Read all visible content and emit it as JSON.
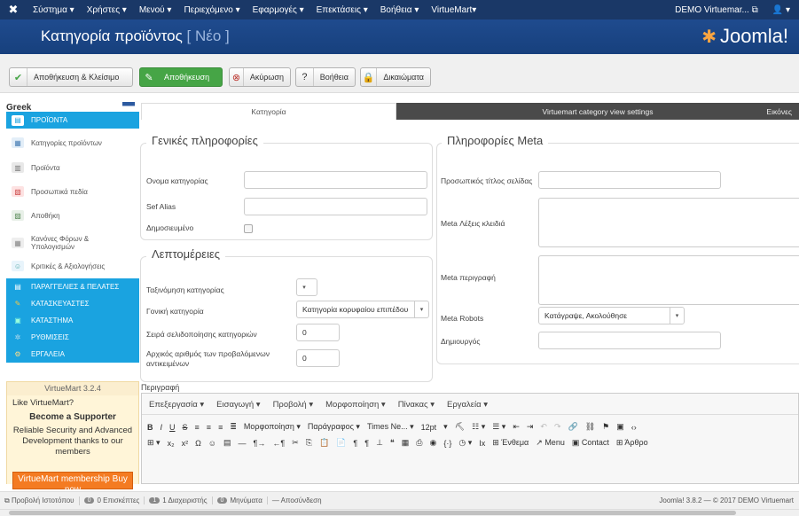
{
  "topbar": {
    "menu": [
      "Σύστημα ▾",
      "Χρήστες ▾",
      "Μενού ▾",
      "Περιεχόμενο ▾",
      "Εφαρμογές ▾",
      "Επεκτάσεις ▾",
      "Βοήθεια ▾",
      "VirtueMart▾"
    ],
    "site": "DEMO Virtuemar...",
    "site_icon": "external-link-icon",
    "user_icon": "user-icon"
  },
  "header": {
    "title": "Κατηγορία προϊόντος",
    "title_sub": "[ Νέο ]",
    "brand": "Joomla!"
  },
  "toolbar": {
    "save_close": "Αποθήκευση & Κλείσιμο",
    "save": "Αποθήκευση",
    "cancel": "Ακύρωση",
    "help": "Βοήθεια",
    "permissions": "Δικαιώματα"
  },
  "sidebar": {
    "language": "Greek",
    "items": [
      {
        "label": "ΠΡΟΪΟΝΤΑ",
        "type": "active"
      },
      {
        "label": "Κατηγορίες προϊόντων",
        "type": "item"
      },
      {
        "label": "Προϊόντα",
        "type": "item"
      },
      {
        "label": "Προσωπικά πεδία",
        "type": "item"
      },
      {
        "label": "Αποθήκη",
        "type": "item"
      },
      {
        "label": "Κανόνες Φόρων & Υπολογισμών",
        "type": "item"
      },
      {
        "label": "Κριτικές & Αξιολογήσεις",
        "type": "item"
      },
      {
        "label": "ΠΑΡΑΓΓΕΛΙΕΣ & ΠΕΛΑΤΕΣ",
        "type": "section"
      },
      {
        "label": "ΚΑΤΑΣΚΕΥΑΣΤΕΣ",
        "type": "section"
      },
      {
        "label": "ΚΑΤΑΣΤΗΜΑ",
        "type": "section"
      },
      {
        "label": "ΡΥΘΜΙΣΕΙΣ",
        "type": "section"
      },
      {
        "label": "ΕΡΓΑΛΕΙΑ",
        "type": "section"
      }
    ],
    "promo": {
      "version": "VirtueMart 3.2.4",
      "question": "Like VirtueMart?",
      "heading": "Become a Supporter",
      "text": "Reliable Security and Advanced Development thanks to our members",
      "buy": "VirtueMart membership Buy now"
    }
  },
  "tabs": {
    "t1": "Κατηγορία",
    "t2": "Virtuemart category view settings",
    "t3": "Εικόνες"
  },
  "general": {
    "legend": "Γενικές πληροφορίες",
    "name_label": "Ονομα κατηγορίας",
    "name_value": "",
    "alias_label": "Sef Alias",
    "alias_value": "",
    "published_label": "Δημοσιευμένο"
  },
  "details": {
    "legend": "Λεπτομέρειες",
    "ordering_label": "Ταξινόμηση κατηγορίας",
    "ordering_value": "",
    "parent_label": "Γονική κατηγορία",
    "parent_value": "Κατηγορία κορυφαίου επιπέδου",
    "subcat_order_label": "Σειρά σελιδοποίησης κατηγοριών",
    "subcat_order_value": "0",
    "initial_items_label": "Αρχικός αριθμός των προβαλόμενων αντικειμένων",
    "initial_items_value": "0"
  },
  "meta": {
    "legend": "Πληροφορίες Meta",
    "page_title_label": "Προσωπικός τίτλος σελίδας",
    "keywords_label": "Meta Λέξεις κλειδιά",
    "description_label": "Meta περιγραφή",
    "robots_label": "Meta Robots",
    "robots_value": "Κατάγραψε, Ακολούθησε",
    "author_label": "Δημιουργός"
  },
  "editor": {
    "label": "Περιγραφή",
    "menus": [
      "Επεξεργασία ▾",
      "Εισαγωγή ▾",
      "Προβολή ▾",
      "Μορφοποίηση ▾",
      "Πίνακας ▾",
      "Εργαλεία ▾"
    ],
    "format": "Μορφοποίηση ▾",
    "paragraph": "Παράγραφος ▾",
    "font": "Times Ne... ▾",
    "size": "12pt",
    "btn_article_in": "Ένθεμα",
    "btn_menu": "Menu",
    "btn_contact": "Contact",
    "btn_article": "Άρθρο"
  },
  "status": {
    "preview": "Προβολή Ιστοτόπου",
    "visitors_count": "0",
    "visitors": "0 Επισκέπτες",
    "admins_count": "1",
    "admins": "1 Διαχειριστής",
    "messages_count": "0",
    "messages": "Μηνύματα",
    "logout": "— Αποσύνδεση",
    "copyright": "Joomla! 3.8.2 — © 2017 DEMO Virtuemart"
  }
}
